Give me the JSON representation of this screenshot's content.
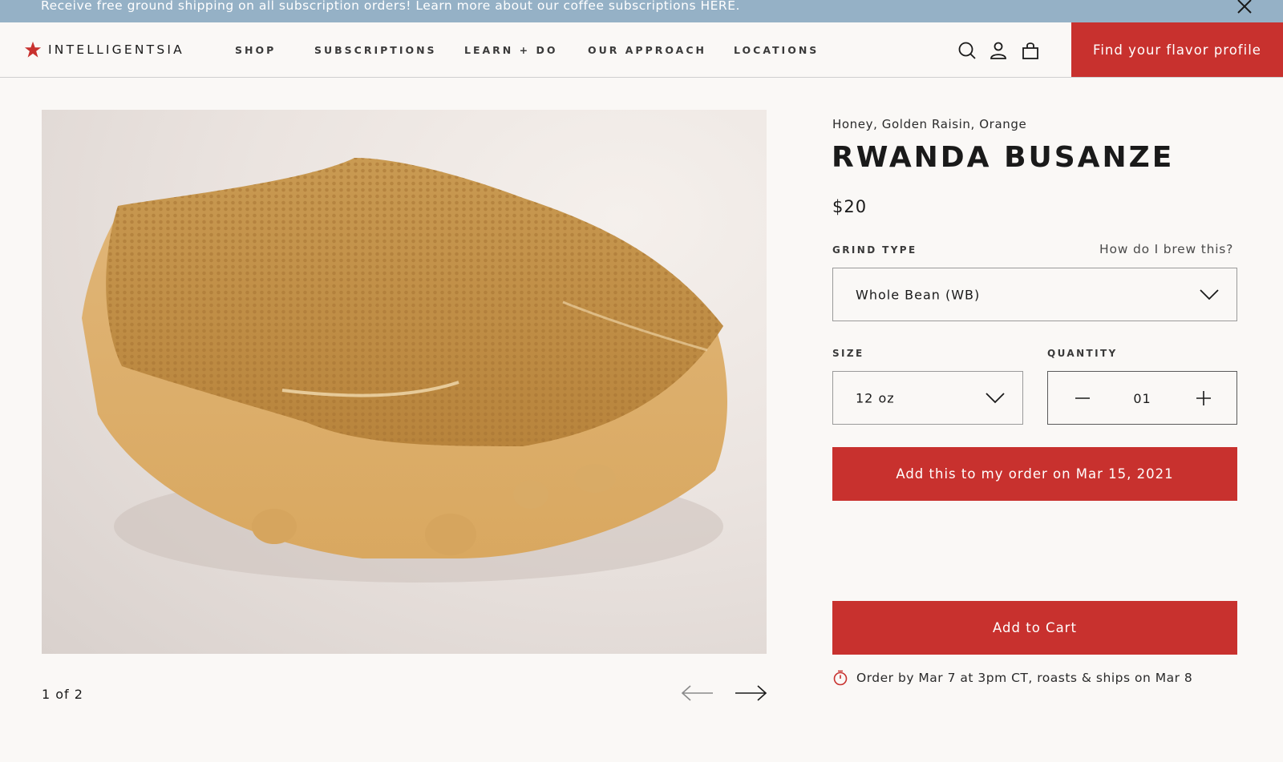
{
  "announcement": {
    "text": "Receive free ground shipping on all subscription orders! Learn more about our coffee subscriptions HERE.",
    "close_icon": "close-icon"
  },
  "header": {
    "logo_text": "INTELLIGENTSIA",
    "nav": [
      "SHOP",
      "SUBSCRIPTIONS",
      "LEARN + DO",
      "OUR APPROACH",
      "LOCATIONS"
    ],
    "icons": [
      "search-icon",
      "account-icon",
      "cart-icon"
    ],
    "cta_label": "Find your flavor profile"
  },
  "gallery": {
    "counter": "1 of 2",
    "prev_icon": "arrow-left-icon",
    "next_icon": "arrow-right-icon"
  },
  "product": {
    "tasting_notes": "Honey, Golden Raisin, Orange",
    "name": "RWANDA BUSANZE",
    "price": "$20",
    "grind_label": "GRIND TYPE",
    "brew_link": "How do I brew this?",
    "grind_value": "Whole Bean (WB)",
    "size_label": "SIZE",
    "size_value": "12 oz",
    "quantity_label": "QUANTITY",
    "quantity_value": "01",
    "subscription_button": "Add this to my order on Mar 15, 2021",
    "add_to_cart": "Add to Cart",
    "shipping_note": "Order by Mar 7 at 3pm CT, roasts & ships on Mar 8"
  },
  "colors": {
    "brand_red": "#c8312e",
    "announce_blue": "#95b1c6",
    "page_bg": "#faf8f6"
  }
}
